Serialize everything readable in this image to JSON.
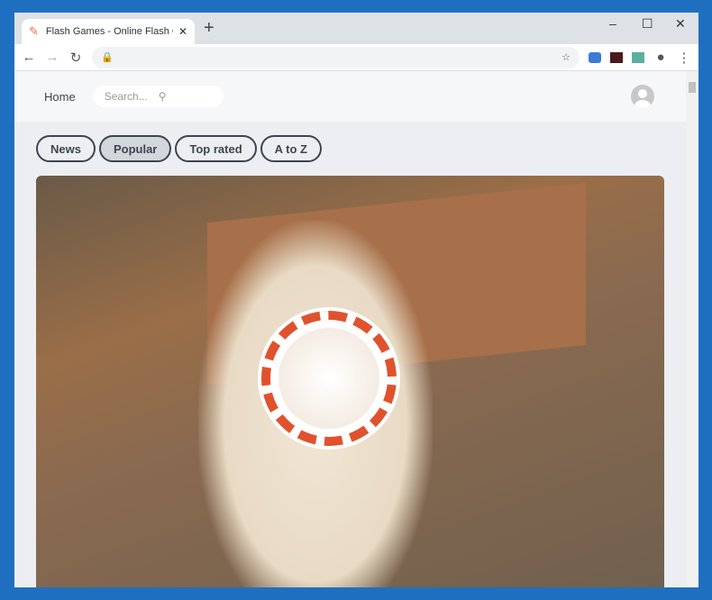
{
  "browser": {
    "tab_title": "Flash Games - Online Flash Games",
    "url": "",
    "window_controls": [
      "minimize",
      "maximize",
      "close"
    ]
  },
  "header": {
    "home": "Home",
    "search_placeholder": "Search..."
  },
  "categories": [
    {
      "label": "News",
      "selected": false
    },
    {
      "label": "Popular",
      "selected": true
    },
    {
      "label": "Top rated",
      "selected": false
    },
    {
      "label": "A to Z",
      "selected": false
    }
  ],
  "colors": {
    "frame": "#1f6fc0",
    "pill_border": "#3e4550",
    "spinner": "#e0522e"
  }
}
